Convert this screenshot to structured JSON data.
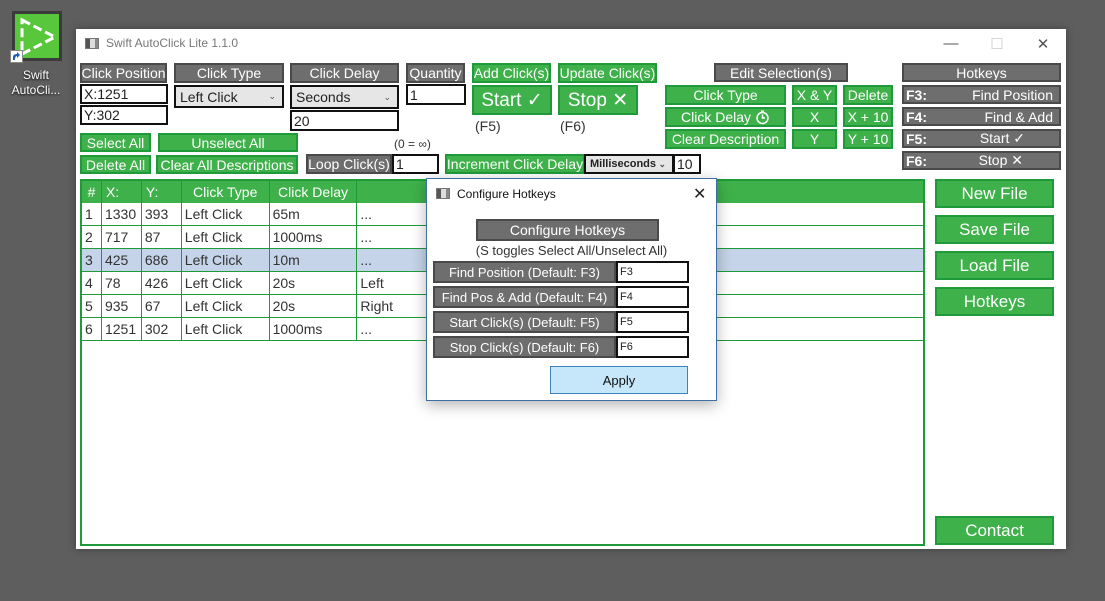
{
  "desktop": {
    "icon_label": "Swift AutoCli..."
  },
  "window": {
    "title": "Swift AutoClick Lite 1.1.0",
    "minimize": "—",
    "maximize": "☐",
    "close": "✕"
  },
  "click_position": {
    "header": "Click Position",
    "x_value": "X:1251",
    "y_value": "Y:302"
  },
  "click_type": {
    "header": "Click Type",
    "selected": "Left Click"
  },
  "click_delay": {
    "header": "Click Delay",
    "unit_selected": "Seconds",
    "value": "20"
  },
  "quantity": {
    "header": "Quantity",
    "value": "1"
  },
  "actions": {
    "add_clicks": "Add Click(s)",
    "update_clicks": "Update Click(s)",
    "start": "Start ✓",
    "stop": "Stop ✕",
    "start_hint": "(F5)",
    "stop_hint": "(F6)"
  },
  "selection": {
    "select_all": "Select All",
    "unselect_all": "Unselect All",
    "delete_all": "Delete All",
    "clear_all_descriptions": "Clear All Descriptions"
  },
  "loop": {
    "label": "Loop Click(s)",
    "value": "1",
    "hint": "(0 = ∞)"
  },
  "increment": {
    "label": "Increment Click Delay",
    "unit_selected": "Milliseconds",
    "value": "10"
  },
  "edit_selection": {
    "header": "Edit Selection(s)",
    "click_type": "Click Type",
    "click_delay": "Click Delay",
    "clear_description": "Clear Description",
    "x_and_y": "X & Y",
    "x": "X",
    "y": "Y",
    "delete": "Delete",
    "x_plus_10": "X + 10",
    "y_plus_10": "Y + 10"
  },
  "hotkeys_panel": {
    "header": "Hotkeys",
    "items": [
      {
        "key": "F3:",
        "action": "Find Position"
      },
      {
        "key": "F4:",
        "action": "Find & Add"
      },
      {
        "key": "F5:",
        "action": "Start ✓"
      },
      {
        "key": "F6:",
        "action": "Stop ✕"
      }
    ]
  },
  "table": {
    "columns": [
      "#",
      "X:",
      "Y:",
      "Click Type",
      "Click Delay",
      ""
    ],
    "rows": [
      {
        "num": "1",
        "x": "1330",
        "y": "393",
        "type": "Left Click",
        "delay": "65m",
        "desc": "..."
      },
      {
        "num": "2",
        "x": "717",
        "y": "87",
        "type": "Left Click",
        "delay": "1000ms",
        "desc": "..."
      },
      {
        "num": "3",
        "x": "425",
        "y": "686",
        "type": "Left Click",
        "delay": "10m",
        "desc": "...",
        "selected": true
      },
      {
        "num": "4",
        "x": "78",
        "y": "426",
        "type": "Left Click",
        "delay": "20s",
        "desc": "Left"
      },
      {
        "num": "5",
        "x": "935",
        "y": "67",
        "type": "Left Click",
        "delay": "20s",
        "desc": "Right"
      },
      {
        "num": "6",
        "x": "1251",
        "y": "302",
        "type": "Left Click",
        "delay": "1000ms",
        "desc": "..."
      }
    ]
  },
  "file_buttons": {
    "new_file": "New File",
    "save_file": "Save File",
    "load_file": "Load File",
    "hotkeys": "Hotkeys",
    "contact": "Contact"
  },
  "dialog": {
    "title": "Configure Hotkeys",
    "close": "✕",
    "header": "Configure Hotkeys",
    "subtitle": "(S toggles Select All/Unselect All)",
    "rows": [
      {
        "label": "Find Position (Default: F3)",
        "value": "F3"
      },
      {
        "label": "Find Pos & Add (Default: F4)",
        "value": "F4"
      },
      {
        "label": "Start Click(s) (Default: F5)",
        "value": "F5"
      },
      {
        "label": "Stop Click(s) (Default: F6)",
        "value": "F6"
      }
    ],
    "apply": "Apply"
  },
  "colors": {
    "green": "#3fb14a",
    "green_border": "#1f9a3a",
    "gray": "#6e6e6e",
    "selected_row": "#c5d4e8",
    "apply_button": "#c6e6fa"
  }
}
